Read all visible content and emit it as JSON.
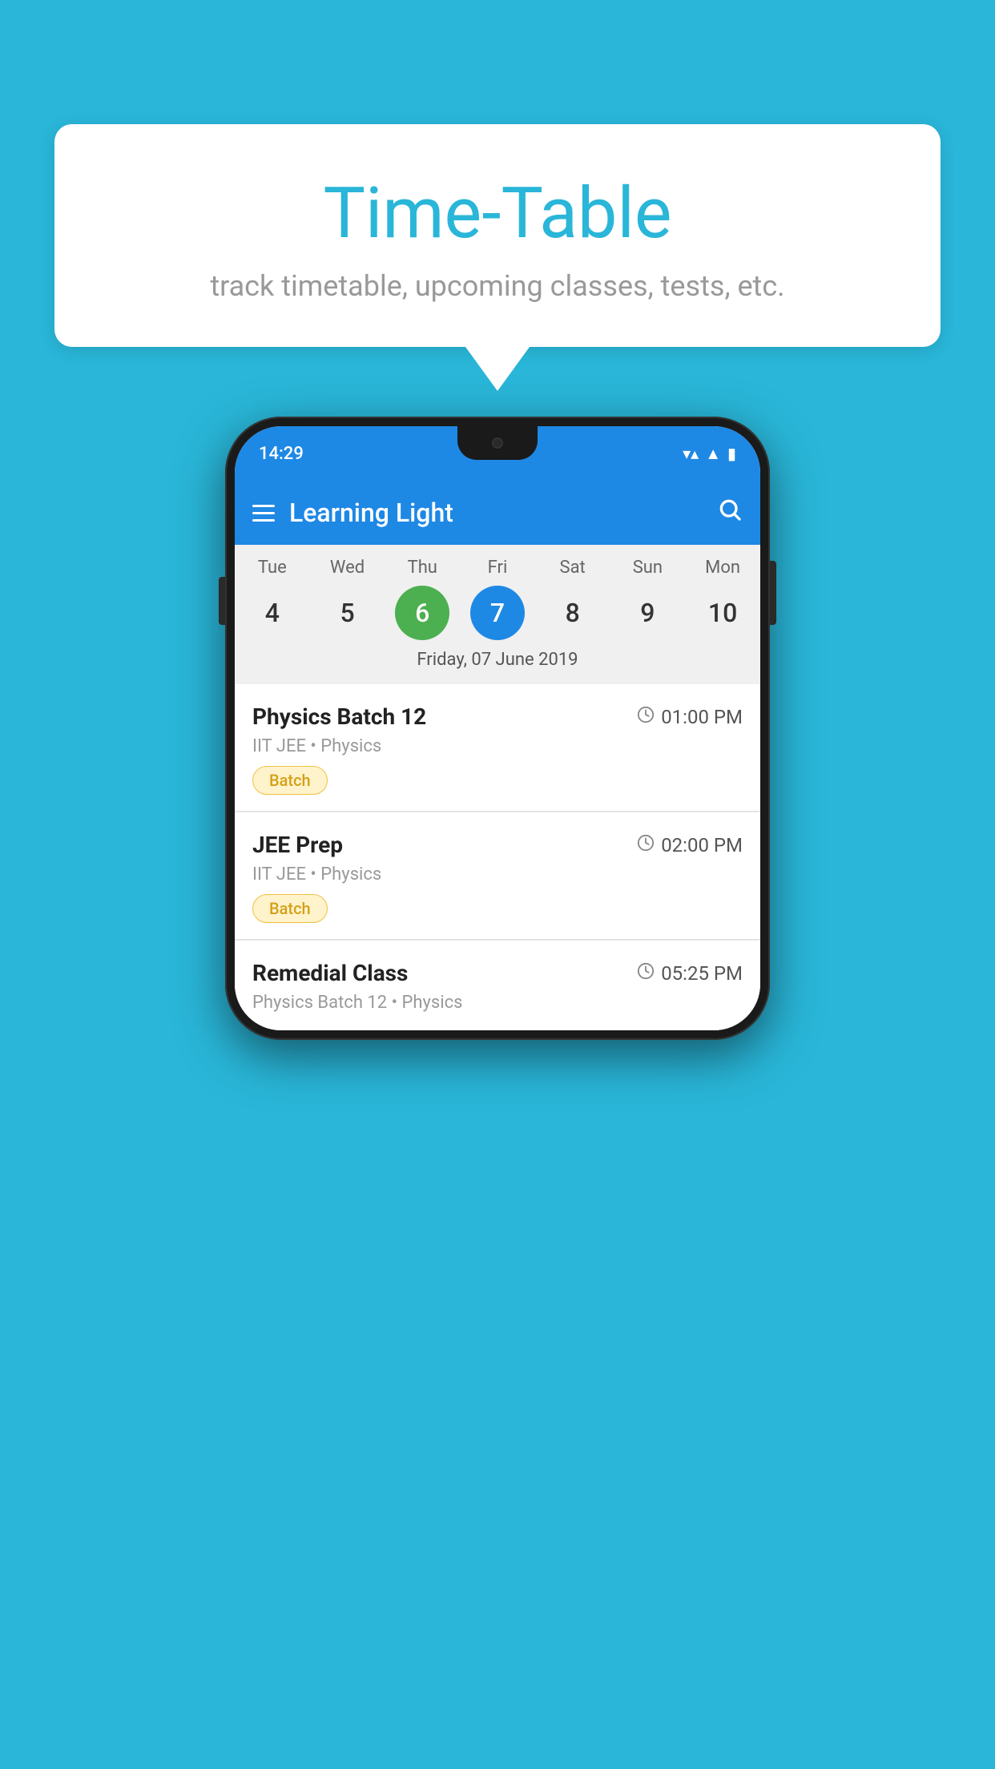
{
  "background_color": "#29B6D8",
  "speech_bubble": {
    "title": "Time-Table",
    "subtitle": "track timetable, upcoming classes, tests, etc."
  },
  "phone": {
    "status_bar": {
      "time": "14:29"
    },
    "app_header": {
      "title": "Learning Light"
    },
    "calendar": {
      "days": [
        "Tue",
        "Wed",
        "Thu",
        "Fri",
        "Sat",
        "Sun",
        "Mon"
      ],
      "dates": [
        "4",
        "5",
        "6",
        "7",
        "8",
        "9",
        "10"
      ],
      "today_index": 2,
      "selected_index": 3,
      "selected_label": "Friday, 07 June 2019"
    },
    "classes": [
      {
        "name": "Physics Batch 12",
        "time": "01:00 PM",
        "meta": "IIT JEE • Physics",
        "badge": "Batch"
      },
      {
        "name": "JEE Prep",
        "time": "02:00 PM",
        "meta": "IIT JEE • Physics",
        "badge": "Batch"
      },
      {
        "name": "Remedial Class",
        "time": "05:25 PM",
        "meta": "Physics Batch 12 • Physics",
        "badge": null
      }
    ]
  },
  "icons": {
    "hamburger": "☰",
    "search": "🔍",
    "clock": "🕐",
    "wifi": "▲",
    "signal": "▲",
    "battery": "▮"
  }
}
